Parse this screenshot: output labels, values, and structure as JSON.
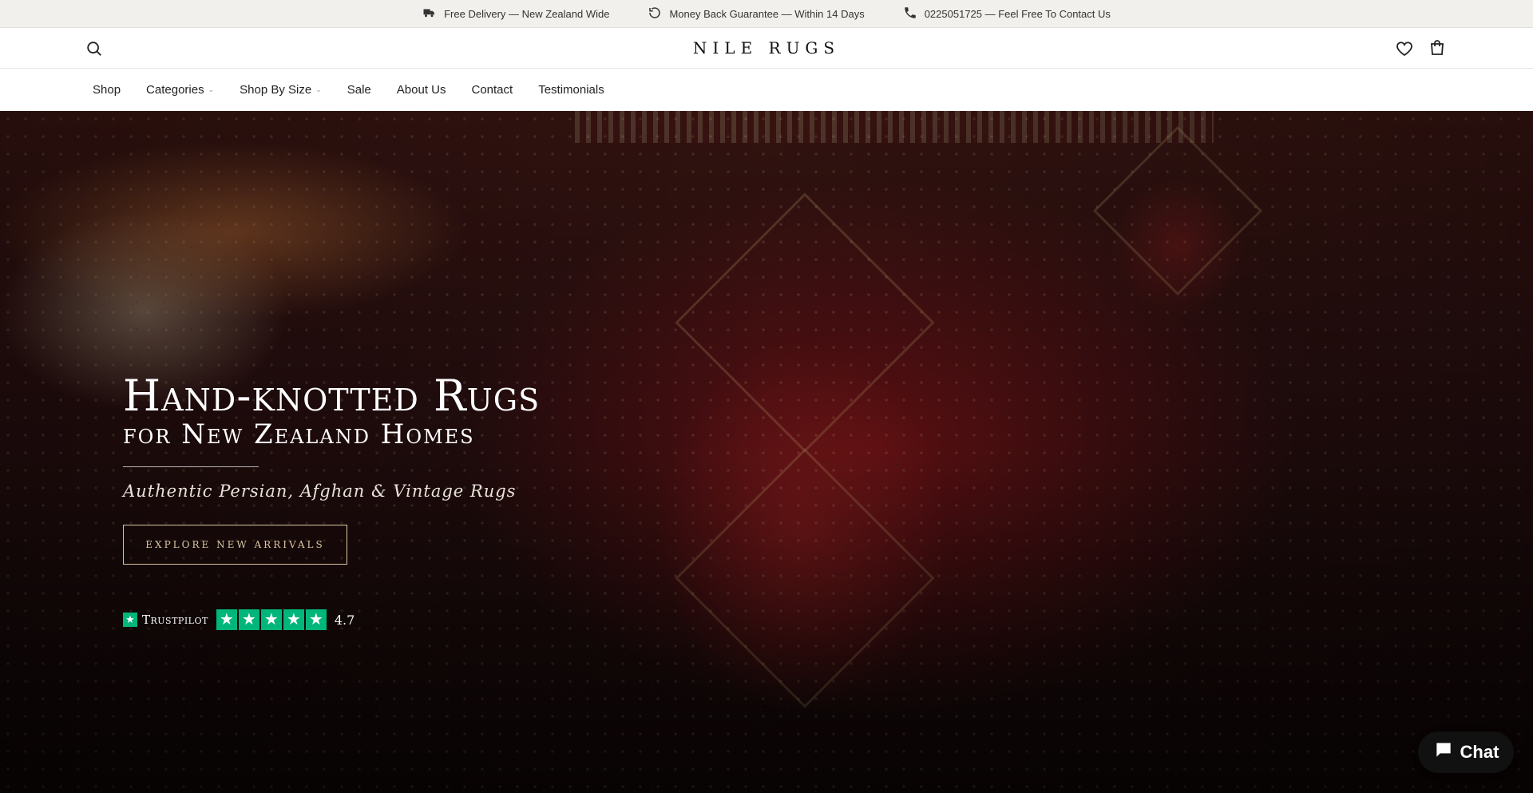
{
  "announcements": [
    {
      "icon": "truck-icon",
      "text": "Free Delivery — New Zealand Wide"
    },
    {
      "icon": "refresh-icon",
      "text": "Money Back Guarantee — Within 14 Days"
    },
    {
      "icon": "phone-icon",
      "text": "0225051725 — Feel Free To Contact Us"
    }
  ],
  "header": {
    "logo": "NILE RUGS",
    "search_icon": "search-icon",
    "wishlist_icon": "heart-icon",
    "cart_icon": "bag-icon"
  },
  "nav": {
    "items": [
      {
        "label": "Shop",
        "dropdown": false
      },
      {
        "label": "Categories",
        "dropdown": true
      },
      {
        "label": "Shop By Size",
        "dropdown": true
      },
      {
        "label": "Sale",
        "dropdown": false
      },
      {
        "label": "About Us",
        "dropdown": false
      },
      {
        "label": "Contact",
        "dropdown": false
      },
      {
        "label": "Testimonials",
        "dropdown": false
      }
    ]
  },
  "hero": {
    "title": "Hand-knotted Rugs",
    "subtitle": "for New Zealand Homes",
    "tagline": "Authentic Persian, Afghan & Vintage Rugs",
    "button": "EXPLORE NEW ARRIVALS",
    "trustpilot": {
      "name": "Trustpilot",
      "rating": "4.7",
      "stars": 5,
      "color": "#00b67a"
    }
  },
  "chat": {
    "label": "Chat"
  }
}
